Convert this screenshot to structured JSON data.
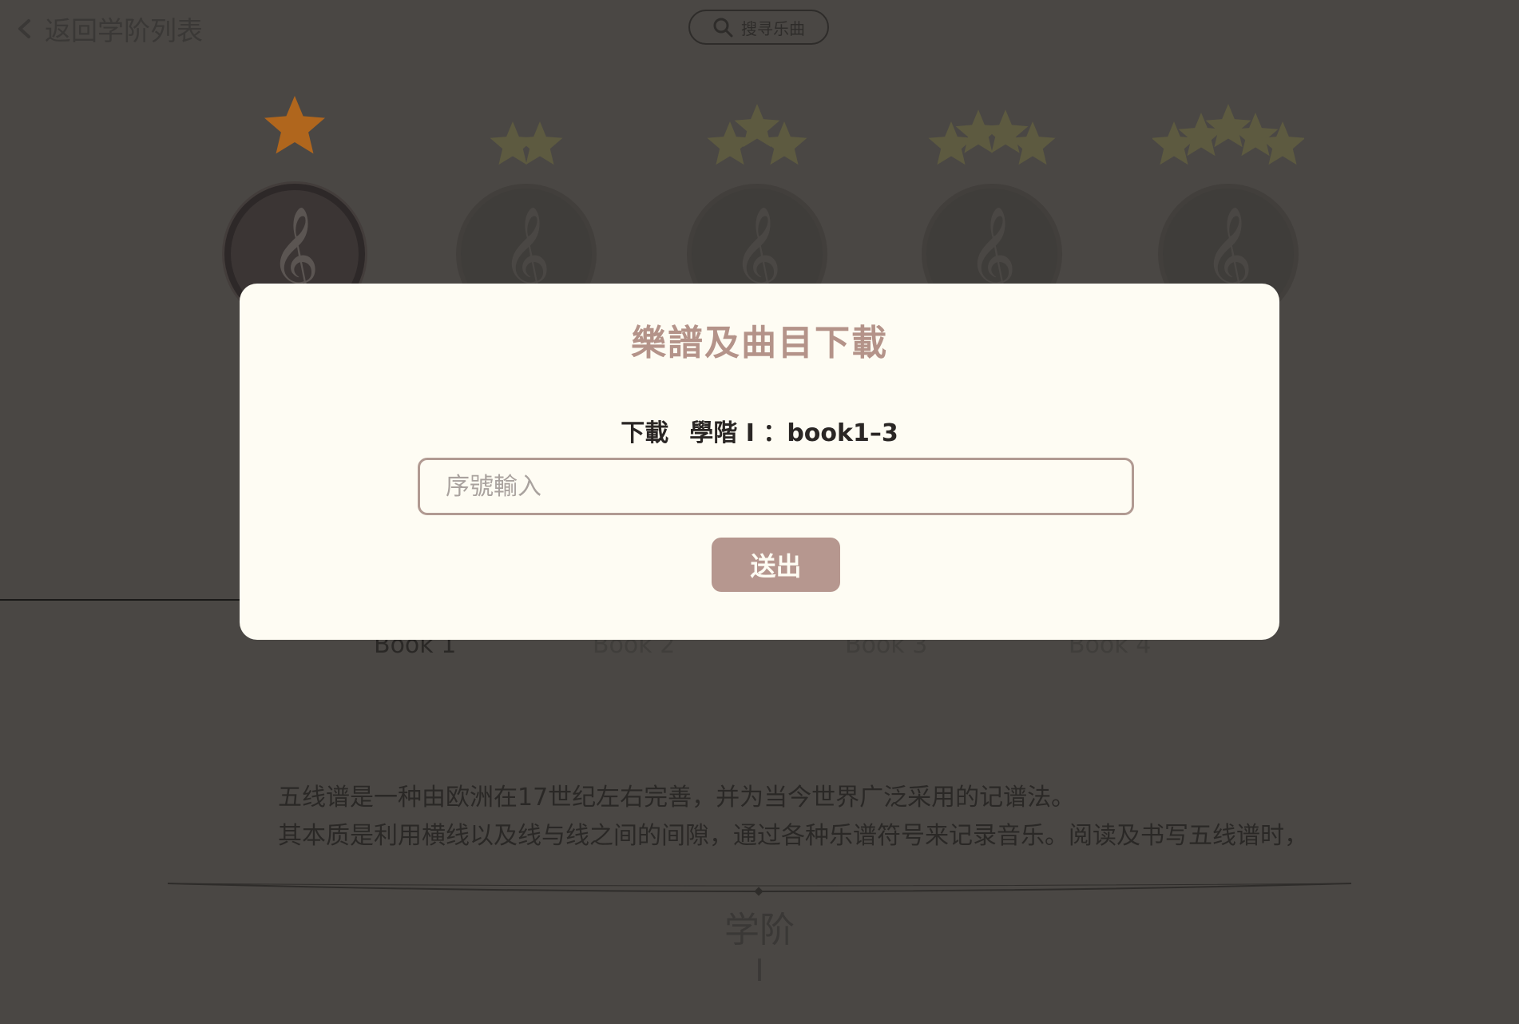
{
  "header": {
    "back_label": "返回学阶列表",
    "search_label": "搜寻乐曲"
  },
  "levels": [
    {
      "stars": 1,
      "status": "active"
    },
    {
      "stars": 2,
      "status": "locked"
    },
    {
      "stars": 3,
      "status": "locked"
    },
    {
      "stars": 4,
      "status": "locked"
    },
    {
      "stars": 5,
      "status": "locked"
    }
  ],
  "level_icon_glyph": "𝄞",
  "books": [
    {
      "label": "Book 1"
    },
    {
      "label": "Book 2"
    },
    {
      "label": "Book 3"
    },
    {
      "label": "Book 4"
    }
  ],
  "description": {
    "line1": "五线谱是一种由欧洲在17世纪左右完善，并为当今世界广泛采用的记谱法。",
    "line2": "其本质是利用横线以及线与线之间的间隙，通过各种乐谱符号来记录音乐。阅读及书写五线谱时，"
  },
  "level_caption": {
    "title": "学阶",
    "number": "I"
  },
  "modal": {
    "title": "樂譜及曲目下載",
    "subtitle_prefix": "下載",
    "subtitle_level": "學階 I ：book1–3",
    "input_placeholder": "序號輸入",
    "input_value": "",
    "submit_label": "送出"
  },
  "colors": {
    "background": "#4a4744",
    "modal_bg": "#fefcf3",
    "accent": "#b6978f",
    "title_color": "#b49389",
    "star_active": "#b0661d",
    "star_locked": "#5d5a40"
  }
}
